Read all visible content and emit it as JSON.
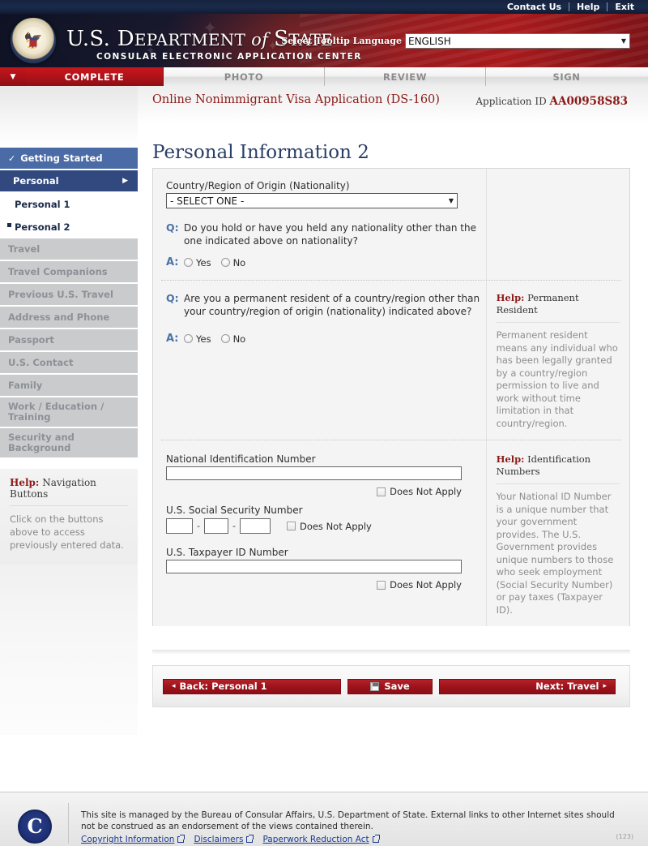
{
  "topbar": {
    "links": [
      "Contact Us",
      "Help",
      "Exit"
    ]
  },
  "banner": {
    "title_us": "U.S. D",
    "title_epartment": "EPARTMENT",
    "title_of": " of ",
    "title_s": "S",
    "title_tate": "TATE",
    "subtitle": "CONSULAR ELECTRONIC APPLICATION CENTER",
    "language_label": "Select Tooltip Language",
    "language_value": "ENGLISH",
    "seal_alt": "us-department-of-state-seal"
  },
  "tabs": [
    {
      "label": "COMPLETE",
      "active": true
    },
    {
      "label": "PHOTO",
      "active": false
    },
    {
      "label": "REVIEW",
      "active": false
    },
    {
      "label": "SIGN",
      "active": false
    }
  ],
  "sidebar": {
    "items": [
      {
        "label": "Getting Started",
        "state": "done"
      },
      {
        "label": "Personal",
        "state": "current-group"
      },
      {
        "label": "Personal 1",
        "state": "sub"
      },
      {
        "label": "Personal 2",
        "state": "sub-current"
      },
      {
        "label": "Travel",
        "state": "disabled"
      },
      {
        "label": "Travel Companions",
        "state": "disabled"
      },
      {
        "label": "Previous U.S. Travel",
        "state": "disabled"
      },
      {
        "label": "Address and Phone",
        "state": "disabled"
      },
      {
        "label": "Passport",
        "state": "disabled"
      },
      {
        "label": "U.S. Contact",
        "state": "disabled"
      },
      {
        "label": "Family",
        "state": "disabled"
      },
      {
        "label": "Work / Education / Training",
        "state": "disabled"
      },
      {
        "label": "Security and Background",
        "state": "disabled"
      }
    ],
    "help": {
      "title_prefix": "Help:",
      "title": "Navigation Buttons",
      "body": "Click on the buttons above to access previously entered data."
    }
  },
  "header": {
    "form_title": "Online Nonimmigrant Visa Application (DS-160)",
    "app_id_label": "Application ID",
    "app_id_value": "AA00958S83",
    "page_title": "Personal Information 2"
  },
  "form": {
    "nationality": {
      "label": "Country/Region of Origin (Nationality)",
      "value": "- SELECT ONE -"
    },
    "question1": {
      "q_marker": "Q:",
      "a_marker": "A:",
      "text": "Do you hold or have you held any nationality other than the one indicated above on nationality?",
      "options": [
        "Yes",
        "No"
      ]
    },
    "question2": {
      "q_marker": "Q:",
      "a_marker": "A:",
      "text": "Are you a permanent resident of a country/region other than your country/region of origin (nationality) indicated above?",
      "options": [
        "Yes",
        "No"
      ]
    },
    "national_id": {
      "label": "National Identification Number",
      "value": "",
      "does_not_apply": "Does Not Apply"
    },
    "ssn": {
      "label": "U.S. Social Security Number",
      "part1": "",
      "part2": "",
      "part3": "",
      "separator": "-",
      "does_not_apply": "Does Not Apply"
    },
    "taxpayer_id": {
      "label": "U.S. Taxpayer ID Number",
      "value": "",
      "does_not_apply": "Does Not Apply"
    }
  },
  "help_panels": {
    "permanent_resident": {
      "title_prefix": "Help:",
      "title": "Permanent Resident",
      "body": "Permanent resident means any individual who has been legally granted by a country/region permission to live and work without time limitation in that country/region."
    },
    "identification_numbers": {
      "title_prefix": "Help:",
      "title": "Identification Numbers",
      "body": "Your National ID Number is a unique number that your government provides. The U.S. Government provides unique numbers to those who seek employment (Social Security Number) or pay taxes (Taxpayer ID)."
    }
  },
  "buttons": {
    "back": "Back: Personal 1",
    "back_arrow": "◂",
    "save": "Save",
    "next": "Next: Travel",
    "next_arrow": "▸"
  },
  "footer": {
    "seal_letter": "C",
    "text": "This site is managed by the Bureau of Consular Affairs, U.S. Department of State. External links to other Internet sites should not be construed as an endorsement of the views contained therein.",
    "links": [
      "Copyright Information",
      "Disclaimers",
      "Paperwork Reduction Act"
    ],
    "code": "(123)"
  },
  "colors": {
    "brand_red": "#8b1a18",
    "nav_blue": "#31497e",
    "done_blue": "#4a6ba5",
    "title_blue": "#2b3e66",
    "link_blue": "#1a3a8f"
  }
}
